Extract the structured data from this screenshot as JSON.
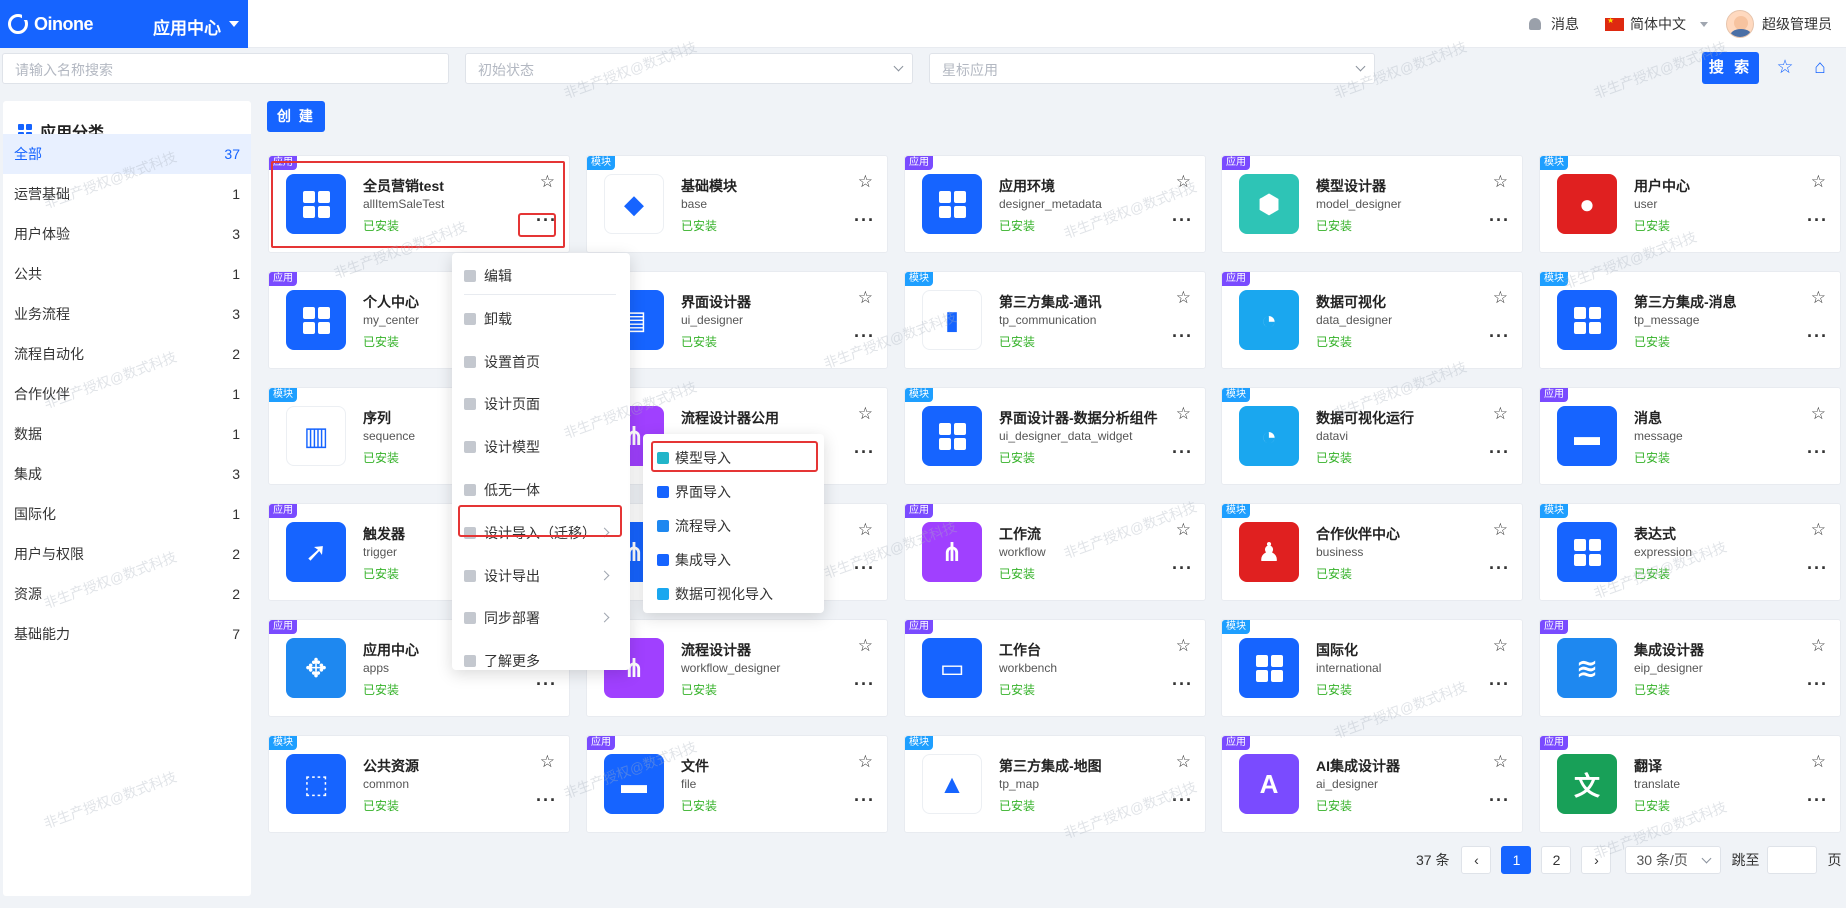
{
  "header": {
    "brand": "Oinone",
    "app_center": "应用中心",
    "messages": "消息",
    "language": "简体中文",
    "user": "超级管理员"
  },
  "filters": {
    "name_placeholder": "请输入名称搜索",
    "status_placeholder": "初始状态",
    "star_placeholder": "星标应用",
    "search_label": "搜 索"
  },
  "sidebar": {
    "title": "应用分类",
    "items": [
      {
        "label": "全部",
        "count": "37"
      },
      {
        "label": "运营基础",
        "count": "1"
      },
      {
        "label": "用户体验",
        "count": "3"
      },
      {
        "label": "公共",
        "count": "1"
      },
      {
        "label": "业务流程",
        "count": "3"
      },
      {
        "label": "流程自动化",
        "count": "2"
      },
      {
        "label": "合作伙伴",
        "count": "1"
      },
      {
        "label": "数据",
        "count": "1"
      },
      {
        "label": "集成",
        "count": "3"
      },
      {
        "label": "国际化",
        "count": "1"
      },
      {
        "label": "用户与权限",
        "count": "2"
      },
      {
        "label": "资源",
        "count": "2"
      },
      {
        "label": "基础能力",
        "count": "7"
      }
    ]
  },
  "create_label": "创 建",
  "status_installed": "已安装",
  "badges": {
    "app": "应用",
    "module": "模块"
  },
  "cards": [
    {
      "name": "全员营销test",
      "code": "allItemSaleTest",
      "badge": "app",
      "color": "#1664ff",
      "icon": "grid-icon"
    },
    {
      "name": "基础模块",
      "code": "base",
      "badge": "module",
      "color": "#ffffff",
      "icon": "blocks-icon"
    },
    {
      "name": "应用环境",
      "code": "designer_metadata",
      "badge": "app",
      "color": "#1664ff",
      "icon": "grid-icon"
    },
    {
      "name": "模型设计器",
      "code": "model_designer",
      "badge": "app",
      "color": "#2ec4b6",
      "icon": "cube-icon"
    },
    {
      "name": "用户中心",
      "code": "user",
      "badge": "module",
      "color": "#e02020",
      "icon": "user-icon"
    },
    {
      "name": "个人中心",
      "code": "my_center",
      "badge": "app",
      "color": "#1664ff",
      "icon": "grid-icon"
    },
    {
      "name": "界面设计器",
      "code": "ui_designer",
      "badge": "app",
      "color": "#1664ff",
      "icon": "layout-icon"
    },
    {
      "name": "第三方集成-通讯",
      "code": "tp_communication",
      "badge": "module",
      "color": "#ffffff",
      "icon": "contact-icon"
    },
    {
      "name": "数据可视化",
      "code": "data_designer",
      "badge": "app",
      "color": "#1aa7ef",
      "icon": "pie-icon"
    },
    {
      "name": "第三方集成-消息",
      "code": "tp_message",
      "badge": "module",
      "color": "#1664ff",
      "icon": "grid-icon"
    },
    {
      "name": "序列",
      "code": "sequence",
      "badge": "module",
      "color": "#ffffff",
      "icon": "barcode-icon"
    },
    {
      "name": "流程设计器公用",
      "code": "",
      "badge": "app",
      "color": "#a040ff",
      "icon": "flow-icon"
    },
    {
      "name": "界面设计器-数据分析组件",
      "code": "ui_designer_data_widget",
      "badge": "module",
      "color": "#1664ff",
      "icon": "grid-icon"
    },
    {
      "name": "数据可视化运行",
      "code": "datavi",
      "badge": "module",
      "color": "#1aa7ef",
      "icon": "pie-icon"
    },
    {
      "name": "消息",
      "code": "message",
      "badge": "app",
      "color": "#1664ff",
      "icon": "message-icon"
    },
    {
      "name": "触发器",
      "code": "trigger",
      "badge": "app",
      "color": "#1664ff",
      "icon": "pointer-icon"
    },
    {
      "name": "",
      "code": "",
      "badge": "app",
      "color": "#1664ff",
      "icon": "flow-icon"
    },
    {
      "name": "工作流",
      "code": "workflow",
      "badge": "app",
      "color": "#a040ff",
      "icon": "flow-icon"
    },
    {
      "name": "合作伙伴中心",
      "code": "business",
      "badge": "module",
      "color": "#e02020",
      "icon": "partner-icon"
    },
    {
      "name": "表达式",
      "code": "expression",
      "badge": "module",
      "color": "#1664ff",
      "icon": "grid-icon"
    },
    {
      "name": "应用中心",
      "code": "apps",
      "badge": "app",
      "color": "#1e88f0",
      "icon": "apps-icon"
    },
    {
      "name": "流程设计器",
      "code": "workflow_designer",
      "badge": "app",
      "color": "#a040ff",
      "icon": "flow-icon"
    },
    {
      "name": "工作台",
      "code": "workbench",
      "badge": "app",
      "color": "#1664ff",
      "icon": "monitor-icon"
    },
    {
      "name": "国际化",
      "code": "international",
      "badge": "module",
      "color": "#1664ff",
      "icon": "grid-icon"
    },
    {
      "name": "集成设计器",
      "code": "eip_designer",
      "badge": "app",
      "color": "#1e88f0",
      "icon": "layers-icon"
    },
    {
      "name": "公共资源",
      "code": "common",
      "badge": "module",
      "color": "#1664ff",
      "icon": "box-icon"
    },
    {
      "name": "文件",
      "code": "file",
      "badge": "app",
      "color": "#1664ff",
      "icon": "folder-icon"
    },
    {
      "name": "第三方集成-地图",
      "code": "tp_map",
      "badge": "module",
      "color": "#ffffff",
      "icon": "map-icon"
    },
    {
      "name": "AI集成设计器",
      "code": "ai_designer",
      "badge": "app",
      "color": "#7a4bff",
      "icon": "ai-icon"
    },
    {
      "name": "翻译",
      "code": "translate",
      "badge": "app",
      "color": "#18a058",
      "icon": "translate-icon"
    }
  ],
  "menu": {
    "items": [
      "编辑",
      "卸载",
      "设置首页",
      "设计页面",
      "设计模型",
      "低无一体",
      "设计导入（迁移）",
      "设计导出",
      "同步部署",
      "了解更多"
    ]
  },
  "submenu": {
    "items": [
      "模型导入",
      "界面导入",
      "流程导入",
      "集成导入",
      "数据可视化导入"
    ]
  },
  "pagination": {
    "total": "37 条",
    "pages": [
      "1",
      "2"
    ],
    "page_size": "30 条/页",
    "jump_label": "跳至",
    "page_unit": "页"
  },
  "watermark_text": "非生产授权@数式科技"
}
